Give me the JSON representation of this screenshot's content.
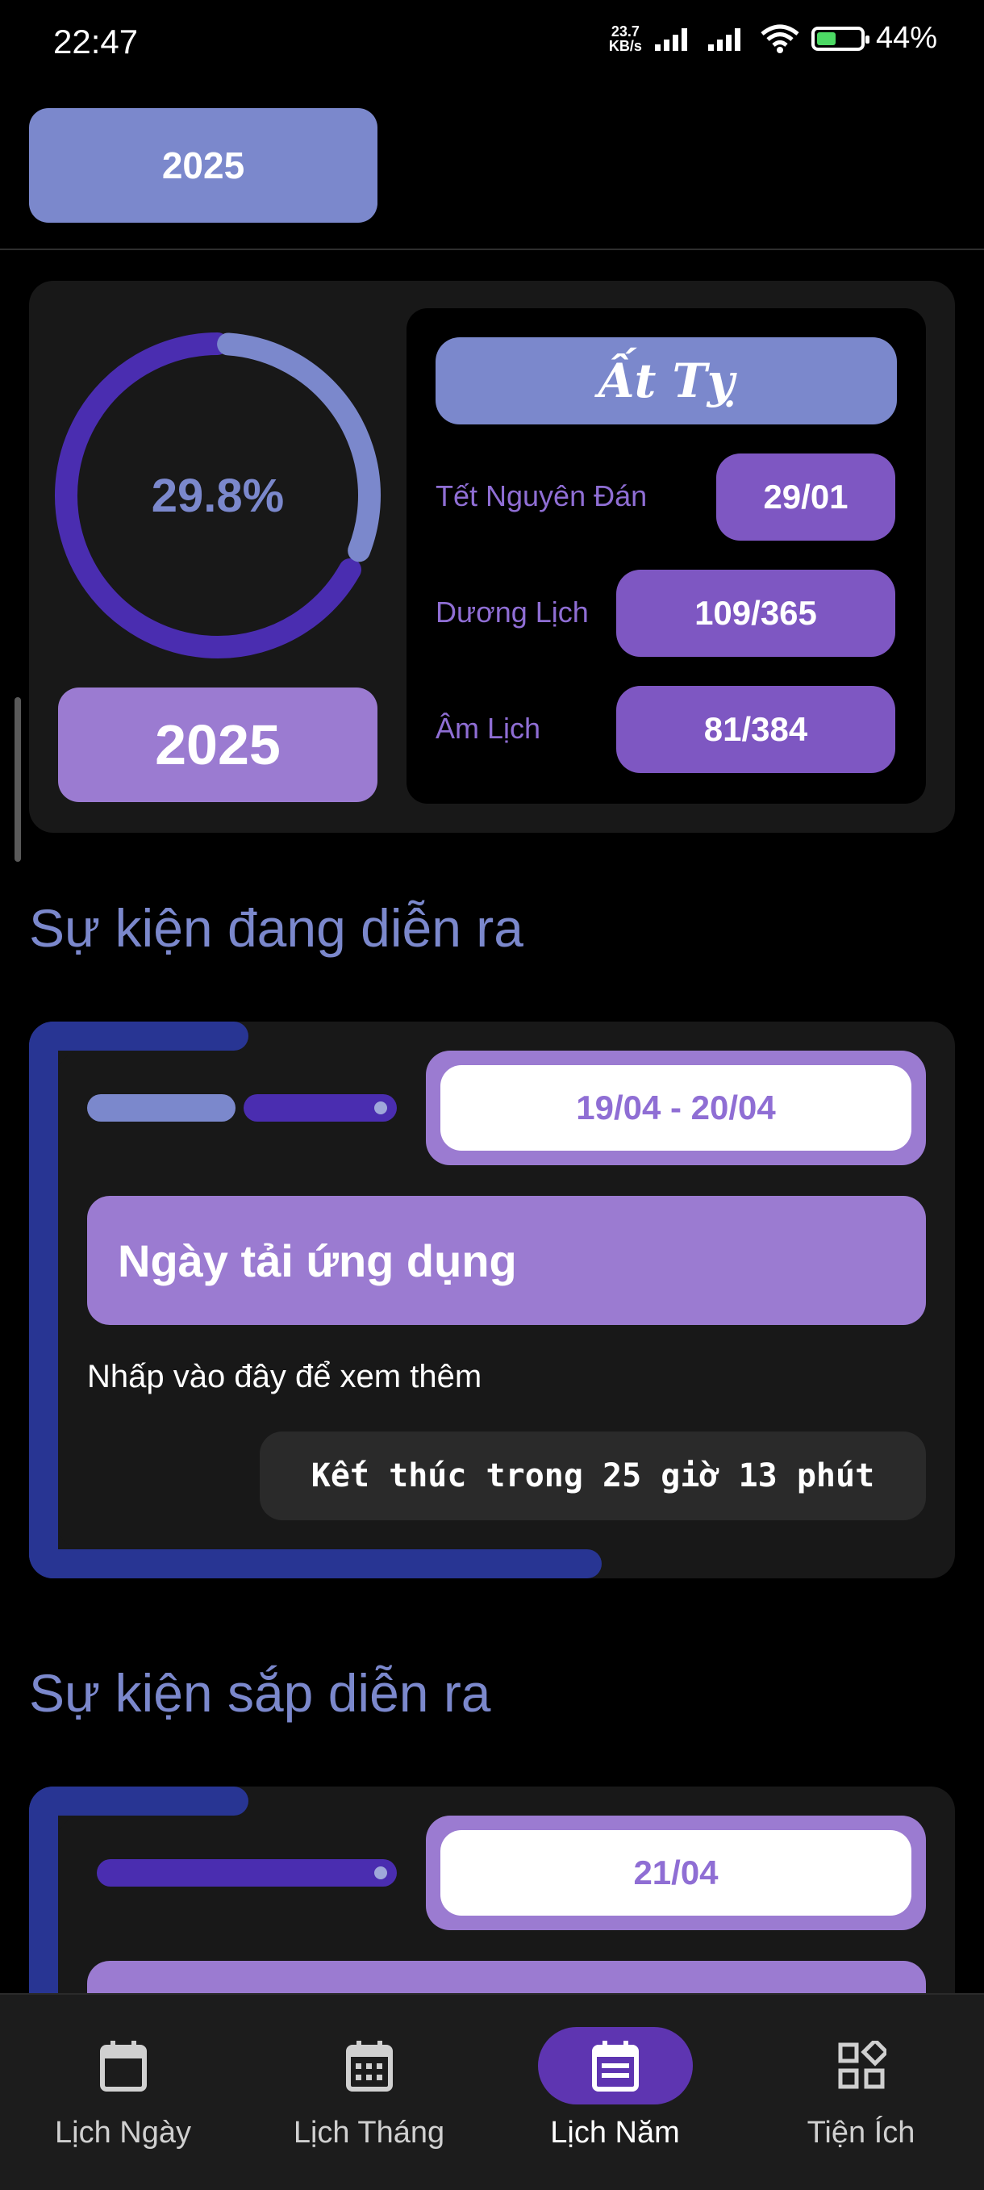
{
  "status_bar": {
    "time": "22:47",
    "net_speed_value": "23.7",
    "net_speed_unit": "KB/s",
    "battery": "44%",
    "battery_level_percent": 44
  },
  "year_selector": {
    "label": "2025"
  },
  "summary": {
    "progress_text": "29.8%",
    "progress_fraction": 0.298,
    "year": "2025",
    "can_chi": "Ất Tỵ",
    "rows": [
      {
        "label": "Tết Nguyên Đán",
        "value": "29/01"
      },
      {
        "label": "Dương Lịch",
        "value": "109/365"
      },
      {
        "label": "Âm Lịch",
        "value": "81/384"
      }
    ]
  },
  "sections": {
    "ongoing_title": "Sự kiện đang diễn ra",
    "upcoming_title": "Sự kiện sắp diễn ra"
  },
  "ongoing_event": {
    "date_range": "19/04 - 20/04",
    "title": "Ngày tải ứng dụng",
    "subtitle": "Nhấp vào đây để xem thêm",
    "countdown": "Kết thúc trong 25 giờ 13 phút"
  },
  "upcoming_event": {
    "date": "21/04"
  },
  "nav": {
    "items": [
      {
        "label": "Lịch Ngày",
        "icon": "calendar-icon"
      },
      {
        "label": "Lịch Tháng",
        "icon": "calendar-month-icon"
      },
      {
        "label": "Lịch Năm",
        "icon": "calendar-year-icon",
        "active": true
      },
      {
        "label": "Tiện Ích",
        "icon": "widgets-icon"
      }
    ]
  },
  "colors": {
    "accent_periwinkle": "#7b88cc",
    "accent_purple": "#7e57c2",
    "accent_lavender": "#9b7bd1",
    "accent_deep_purple": "#4a2db0",
    "accent_blue": "#283593",
    "card_bg": "#181818"
  }
}
